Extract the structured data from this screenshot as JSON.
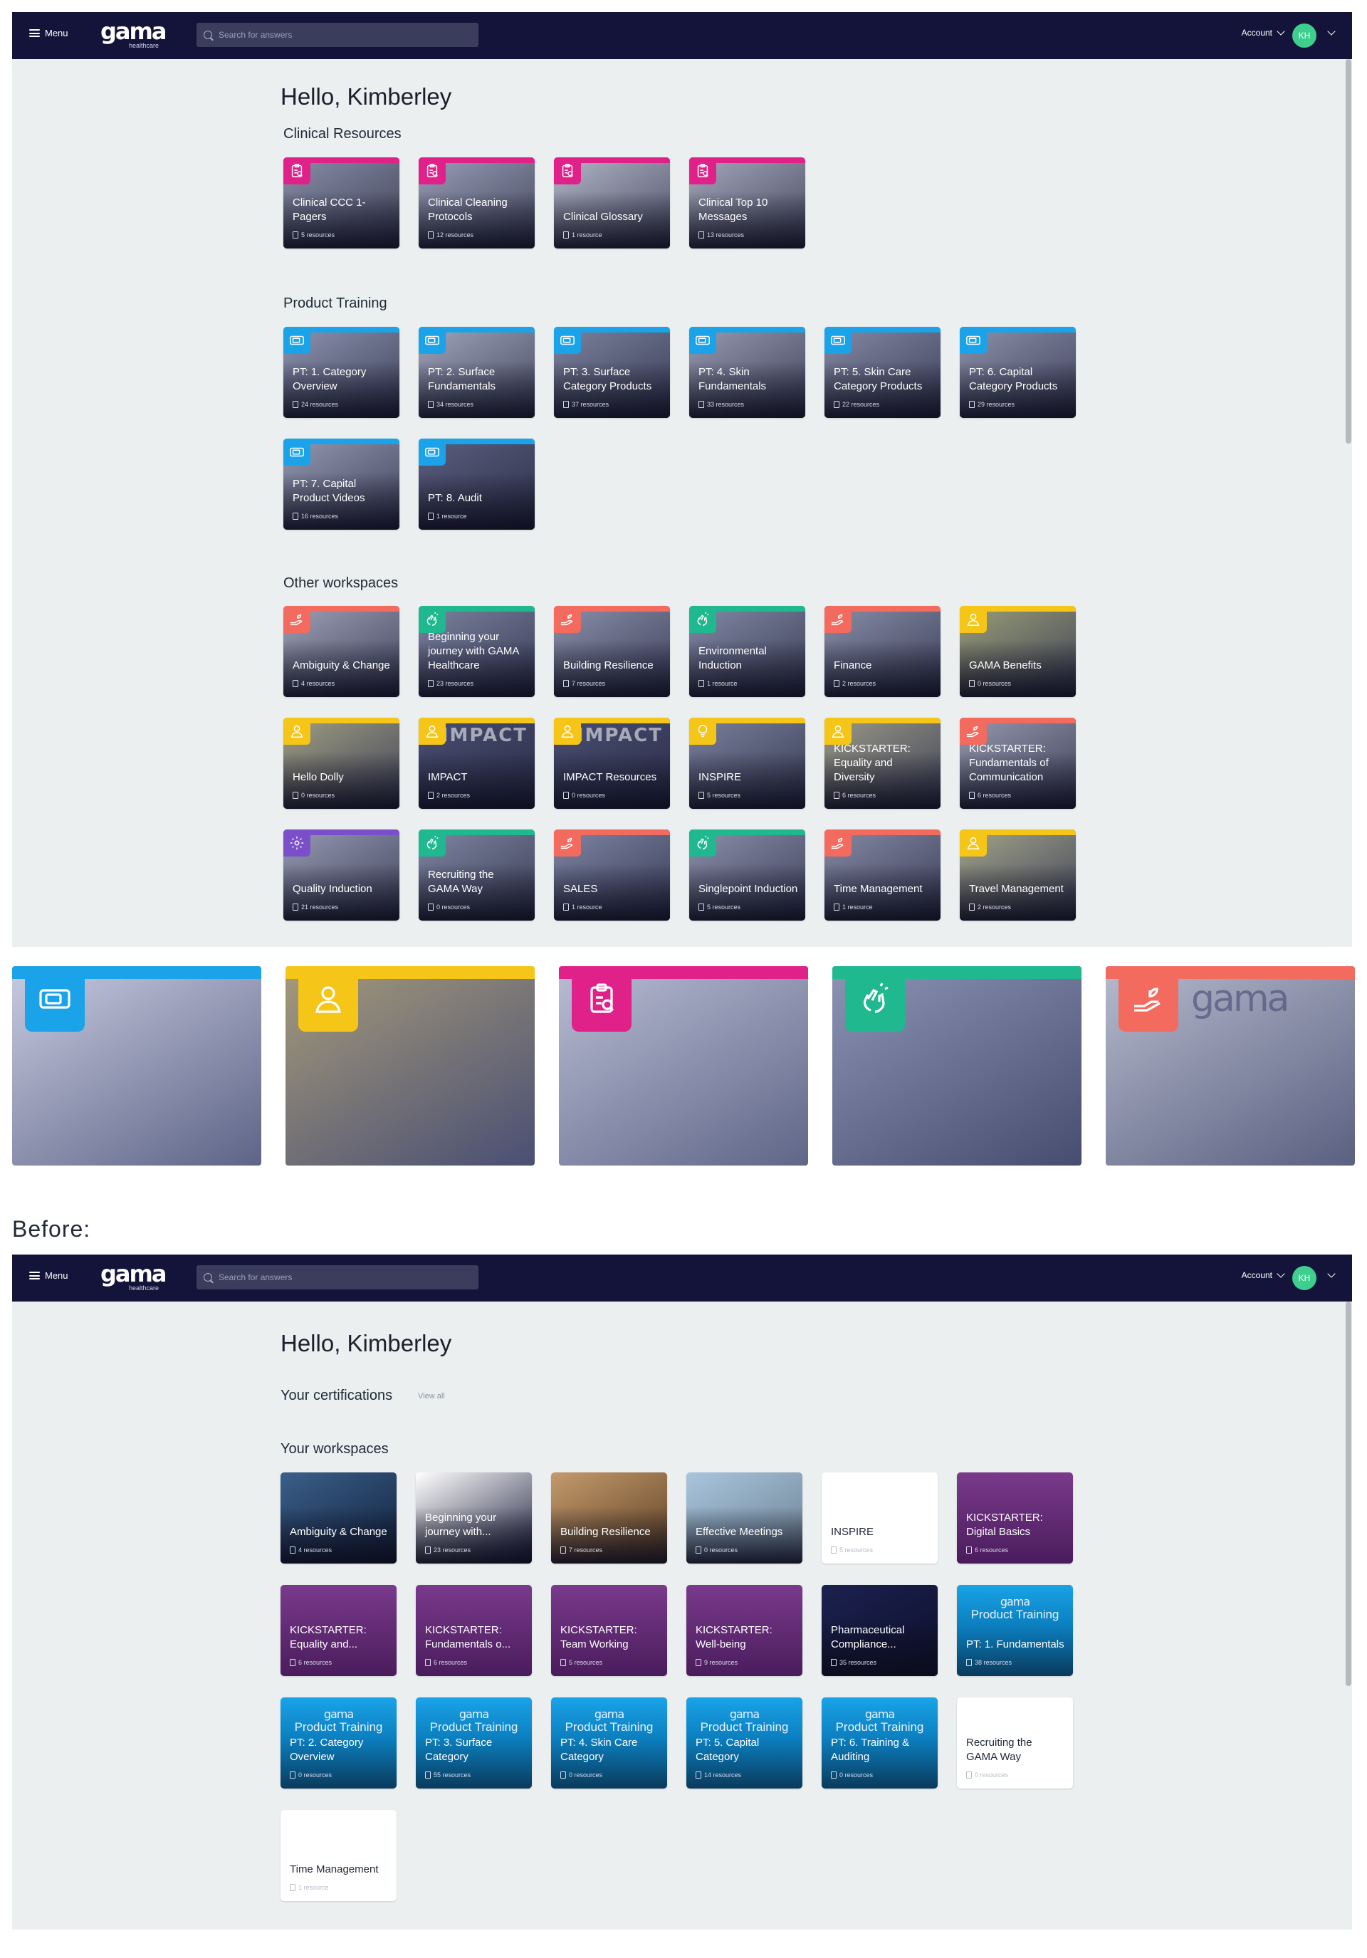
{
  "nav": {
    "menu_label": "Menu",
    "logo_word": "gama",
    "logo_sub": "healthcare",
    "search_placeholder": "Search for answers",
    "account_label": "Account",
    "avatar_initials": "KH"
  },
  "after": {
    "greeting": "Hello, Kimberley",
    "sections": [
      {
        "title": "Clinical Resources",
        "tiles": [
          {
            "name": "Clinical CCC 1-Pagers",
            "count": "5 resources",
            "icon": "clipboard-icon",
            "color": "#e0218a",
            "bg": [
              "#8a8fa8",
              "#3c3f55"
            ]
          },
          {
            "name": "Clinical Cleaning Protocols",
            "count": "12 resources",
            "icon": "clipboard-icon",
            "color": "#e0218a",
            "bg": [
              "#9aa0b8",
              "#40435a"
            ]
          },
          {
            "name": "Clinical Glossary",
            "count": "1 resource",
            "icon": "clipboard-icon",
            "color": "#e0218a",
            "bg": [
              "#b3b7c8",
              "#4a4d63"
            ]
          },
          {
            "name": "Clinical Top 10 Messages",
            "count": "13 resources",
            "icon": "clipboard-icon",
            "color": "#e0218a",
            "bg": [
              "#a6a9bd",
              "#44475d"
            ]
          }
        ]
      },
      {
        "title": "Product Training",
        "tiles": [
          {
            "name": "PT: 1. Category Overview",
            "count": "24 resources",
            "icon": "screen-icon",
            "color": "#1aa3e8",
            "bg": [
              "#8f96b1",
              "#3a3e58"
            ]
          },
          {
            "name": "PT: 2. Surface Fundamentals",
            "count": "34 resources",
            "icon": "screen-icon",
            "color": "#1aa3e8",
            "bg": [
              "#a1a6bd",
              "#42465e"
            ]
          },
          {
            "name": "PT: 3. Surface Category Products",
            "count": "37 resources",
            "icon": "screen-icon",
            "color": "#1aa3e8",
            "bg": [
              "#7e84a0",
              "#363a52"
            ]
          },
          {
            "name": "PT: 4. Skin Fundamentals",
            "count": "33 resources",
            "icon": "screen-icon",
            "color": "#1aa3e8",
            "bg": [
              "#989cb2",
              "#3d4058"
            ]
          },
          {
            "name": "PT: 5. Skin Care Category Products",
            "count": "22 resources",
            "icon": "screen-icon",
            "color": "#1aa3e8",
            "bg": [
              "#868ba6",
              "#393c55"
            ]
          },
          {
            "name": "PT: 6. Capital Category Products",
            "count": "29 resources",
            "icon": "screen-icon",
            "color": "#1aa3e8",
            "bg": [
              "#8e93ad",
              "#3b3e56"
            ]
          },
          {
            "name": "PT: 7. Capital Product Videos",
            "count": "16 resources",
            "icon": "screen-icon",
            "color": "#1aa3e8",
            "bg": [
              "#959ab3",
              "#3c3f58"
            ]
          },
          {
            "name": "PT: 8. Audit",
            "count": "1 resource",
            "icon": "screen-icon",
            "color": "#1aa3e8",
            "bg": [
              "#5b6080",
              "#2c2f48"
            ]
          }
        ]
      },
      {
        "title": "Other workspaces",
        "tiles": [
          {
            "name": "Ambiguity & Change",
            "count": "4 resources",
            "icon": "hand-plant-icon",
            "color": "#f26b5e",
            "bg": [
              "#9ea2b8",
              "#3e4159"
            ]
          },
          {
            "name": "Beginning your journey with GAMA Healthcare",
            "count": "23 resources",
            "icon": "clap-icon",
            "color": "#1fb88f",
            "bg": [
              "#7d83a0",
              "#353953"
            ]
          },
          {
            "name": "Building Resilience",
            "count": "7 resources",
            "icon": "hand-plant-icon",
            "color": "#f26b5e",
            "bg": [
              "#8c91ab",
              "#393d56"
            ]
          },
          {
            "name": "Environmental Induction",
            "count": "1 resource",
            "icon": "clap-icon",
            "color": "#1fb88f",
            "bg": [
              "#848aa6",
              "#373b54"
            ]
          },
          {
            "name": "Finance",
            "count": "2 resources",
            "icon": "hand-plant-icon",
            "color": "#f26b5e",
            "bg": [
              "#8a8fa9",
              "#383c55"
            ]
          },
          {
            "name": "GAMA Benefits",
            "count": "0 resources",
            "icon": "person-icon",
            "color": "#f5c518",
            "bg": [
              "#9a9f77",
              "#3e4056"
            ]
          },
          {
            "name": "Hello Dolly",
            "count": "0 resources",
            "icon": "person-icon",
            "color": "#f5c518",
            "bg": [
              "#a09f82",
              "#3f4158"
            ]
          },
          {
            "name": "IMPACT",
            "count": "2 resources",
            "icon": "person-icon",
            "color": "#f5c518",
            "bg": [
              "#4a4f72",
              "#2a2d47"
            ],
            "overlay": "IMPACT"
          },
          {
            "name": "IMPACT Resources",
            "count": "0 resources",
            "icon": "person-icon",
            "color": "#f5c518",
            "bg": [
              "#4a4f72",
              "#2a2d47"
            ],
            "overlay": "IMPACT"
          },
          {
            "name": "INSPIRE",
            "count": "5 resources",
            "icon": "bulb-icon",
            "color": "#f5c518",
            "bg": [
              "#7b819d",
              "#353952"
            ]
          },
          {
            "name": "KICKSTARTER: Equality and Diversity",
            "count": "6 resources",
            "icon": "person-icon",
            "color": "#f5c518",
            "bg": [
              "#9b9a86",
              "#3d4057"
            ]
          },
          {
            "name": "KICKSTARTER: Fundamentals of Communication",
            "count": "6 resources",
            "icon": "hand-plant-icon",
            "color": "#f26b5e",
            "bg": [
              "#9699ae",
              "#3c3f58"
            ]
          },
          {
            "name": "Quality Induction",
            "count": "21 resources",
            "icon": "gear-icon",
            "color": "#7b4fc9",
            "bg": [
              "#979cb4",
              "#3d4059"
            ]
          },
          {
            "name": "Recruiting the GAMA Way",
            "count": "0 resources",
            "icon": "clap-icon",
            "color": "#1fb88f",
            "bg": [
              "#8187a3",
              "#363a53"
            ]
          },
          {
            "name": "SALES",
            "count": "1 resource",
            "icon": "hand-plant-icon",
            "color": "#f26b5e",
            "bg": [
              "#7f86a4",
              "#363a54"
            ]
          },
          {
            "name": "Singlepoint Induction",
            "count": "5 resources",
            "icon": "clap-icon",
            "color": "#1fb88f",
            "bg": [
              "#8c91ac",
              "#3a3d56"
            ]
          },
          {
            "name": "Time Management",
            "count": "1 resource",
            "icon": "hand-plant-icon",
            "color": "#f26b5e",
            "bg": [
              "#868ba6",
              "#383b54"
            ]
          },
          {
            "name": "Travel Management",
            "count": "2 resources",
            "icon": "person-icon",
            "color": "#f5c518",
            "bg": [
              "#a3a58a",
              "#3e4157"
            ]
          }
        ]
      }
    ]
  },
  "banners": [
    {
      "icon": "screen-icon",
      "color": "#1aa3e8",
      "bg": [
        "#c8cbe0",
        "#5d6486"
      ]
    },
    {
      "icon": "person-icon",
      "color": "#f5c518",
      "bg": [
        "#a59a7a",
        "#4a4f73"
      ]
    },
    {
      "icon": "clipboard-icon",
      "color": "#e0218a",
      "bg": [
        "#b9bdd4",
        "#5f6687"
      ]
    },
    {
      "icon": "clap-icon",
      "color": "#1fb88f",
      "bg": [
        "#8c93b3",
        "#474d70"
      ]
    },
    {
      "icon": "hand-plant-icon",
      "color": "#f26b5e",
      "bg": [
        "#b6bacd",
        "#5a6080"
      ],
      "text": "gama"
    }
  ],
  "before_label": "Before:",
  "before": {
    "greeting": "Hello, Kimberley",
    "certifications_title": "Your certifications",
    "view_all": "View all",
    "workspaces_title": "Your workspaces",
    "brand_small": "gama",
    "brand_pt": "Product Training",
    "tiles": [
      {
        "name": "Ambiguity & Change",
        "count": "4 resources",
        "style": "photo",
        "bg": [
          "#3b5f8a",
          "#10203a"
        ]
      },
      {
        "name": "Beginning your journey with...",
        "count": "23 resources",
        "style": "photo",
        "bg": [
          "#ffffff",
          "#1b1d3a"
        ]
      },
      {
        "name": "Building Resilience",
        "count": "7 resources",
        "style": "photo",
        "bg": [
          "#c49a6c",
          "#5c3f22"
        ]
      },
      {
        "name": "Effective Meetings",
        "count": "0 resources",
        "style": "photo",
        "bg": [
          "#a9c5dd",
          "#6a7f8f"
        ]
      },
      {
        "name": "INSPIRE",
        "count": "5 resources",
        "style": "white"
      },
      {
        "name": "KICKSTARTER: Digital Basics",
        "count": "6 resources",
        "style": "purple"
      },
      {
        "name": "KICKSTARTER: Equality and...",
        "count": "6 resources",
        "style": "purple"
      },
      {
        "name": "KICKSTARTER: Fundamentals o...",
        "count": "6 resources",
        "style": "purple"
      },
      {
        "name": "KICKSTARTER: Team Working",
        "count": "5 resources",
        "style": "purple"
      },
      {
        "name": "KICKSTARTER: Well-being",
        "count": "9 resources",
        "style": "purple"
      },
      {
        "name": "Pharmaceutical Compliance...",
        "count": "35 resources",
        "style": "photo",
        "bg": [
          "#1c2150",
          "#0c0f2a"
        ]
      },
      {
        "name": "PT: 1. Fundamentals",
        "count": "38 resources",
        "style": "pt"
      },
      {
        "name": "PT: 2. Category Overview",
        "count": "0 resources",
        "style": "pt"
      },
      {
        "name": "PT: 3. Surface Category",
        "count": "55 resources",
        "style": "pt"
      },
      {
        "name": "PT: 4. Skin Care Category",
        "count": "0 resources",
        "style": "pt"
      },
      {
        "name": "PT: 5. Capital Category",
        "count": "14 resources",
        "style": "pt"
      },
      {
        "name": "PT: 6. Training & Auditing",
        "count": "0 resources",
        "style": "pt"
      },
      {
        "name": "Recruiting the GAMA Way",
        "count": "0 resources",
        "style": "white"
      },
      {
        "name": "Time Management",
        "count": "1 resource",
        "style": "white"
      }
    ]
  }
}
